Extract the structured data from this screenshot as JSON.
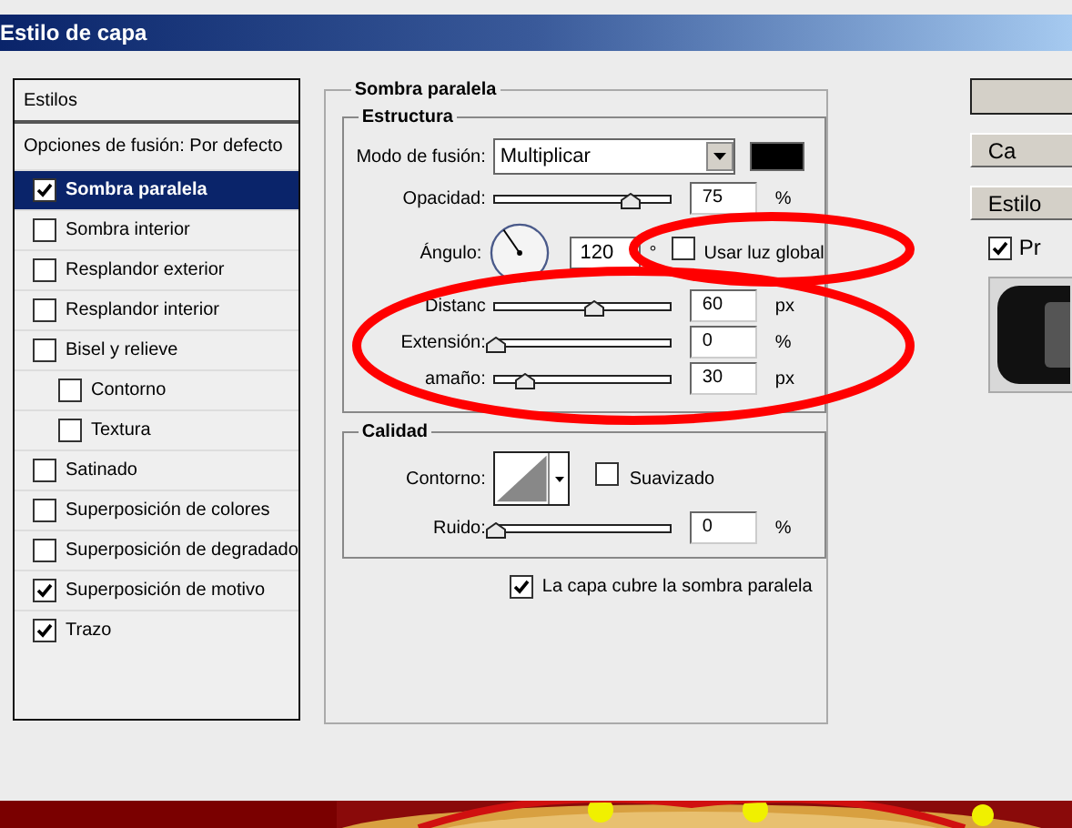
{
  "window": {
    "title": "Estilo de capa"
  },
  "styles_panel": {
    "header": "Estilos",
    "blending_options": "Opciones de fusión: Por defecto",
    "items": [
      {
        "label": "Sombra paralela",
        "checked": true,
        "selected": true
      },
      {
        "label": "Sombra interior",
        "checked": false,
        "selected": false
      },
      {
        "label": "Resplandor exterior",
        "checked": false,
        "selected": false
      },
      {
        "label": "Resplandor interior",
        "checked": false,
        "selected": false
      },
      {
        "label": "Bisel y relieve",
        "checked": false,
        "selected": false,
        "children": [
          {
            "label": "Contorno",
            "checked": false,
            "selected": false
          },
          {
            "label": "Textura",
            "checked": false,
            "selected": false
          }
        ]
      },
      {
        "label": "Satinado",
        "checked": false,
        "selected": false
      },
      {
        "label": "Superposición de colores",
        "checked": false,
        "selected": false
      },
      {
        "label": "Superposición de degradado",
        "checked": false,
        "selected": false
      },
      {
        "label": "Superposición de motivo",
        "checked": true,
        "selected": false
      },
      {
        "label": "Trazo",
        "checked": true,
        "selected": false
      }
    ]
  },
  "drop_shadow": {
    "title": "Sombra paralela",
    "structure": {
      "title": "Estructura",
      "blend_mode": {
        "label": "Modo de fusión:",
        "value": "Multiplicar",
        "color": "#000000"
      },
      "opacity": {
        "label": "Opacidad:",
        "level": 0.77,
        "value": "75",
        "unit": "%"
      },
      "angle": {
        "label": "Ángulo:",
        "value": "120",
        "unit": "°"
      },
      "global_light": {
        "label": "Usar luz global",
        "checked": false
      },
      "sliders": [
        {
          "label": "Distanc",
          "level": 0.56,
          "value": "60",
          "unit": "px"
        },
        {
          "label": "Extensión:",
          "level": 0,
          "value": "0",
          "unit": "%"
        },
        {
          "label": "amaño:",
          "level": 0.17,
          "value": "30",
          "unit": "px"
        }
      ]
    },
    "quality": {
      "title": "Calidad",
      "contour": {
        "label": "Contorno:"
      },
      "antialias": {
        "label": "Suavizado",
        "checked": false
      },
      "noise": {
        "label": "Ruido:",
        "level": 0,
        "value": "0",
        "unit": "%"
      }
    },
    "knockout": {
      "label": "La capa cubre la sombra paralela",
      "checked": true
    }
  },
  "right_panel": {
    "buttons": [
      {
        "kind": "blank"
      },
      {
        "kind": "text",
        "label": "Ca"
      },
      {
        "kind": "text",
        "label": "Estilo"
      }
    ],
    "preview": {
      "label": "Pr",
      "checked": true
    }
  }
}
